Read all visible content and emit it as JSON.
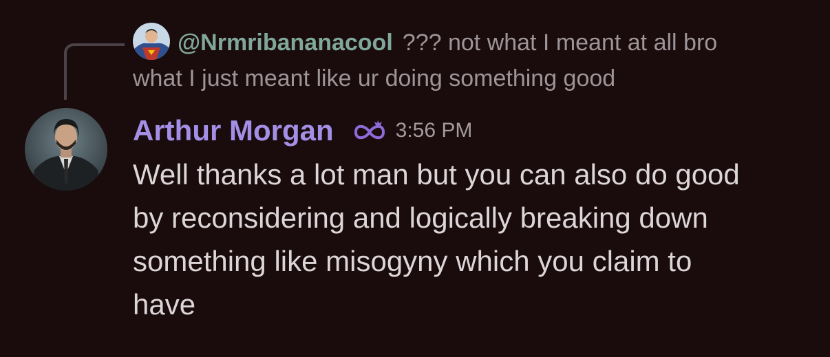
{
  "reply": {
    "mention": "@Nrmribananacool",
    "text_line1": "??? not what I meant at all bro",
    "text_line2": "what I just meant like ur doing something good",
    "avatar_icon": "superhero-avatar-icon"
  },
  "message": {
    "author": "Arthur Morgan",
    "author_color": "#a48fe6",
    "badge_icon": "infinity-nitro-icon",
    "timestamp": "3:56 PM",
    "content_lines": [
      "Well thanks a lot man but you can also do good",
      "by reconsidering and logically breaking down",
      "something like misogyny which you claim to",
      "have"
    ],
    "avatar_icon": "suited-man-avatar-icon"
  }
}
